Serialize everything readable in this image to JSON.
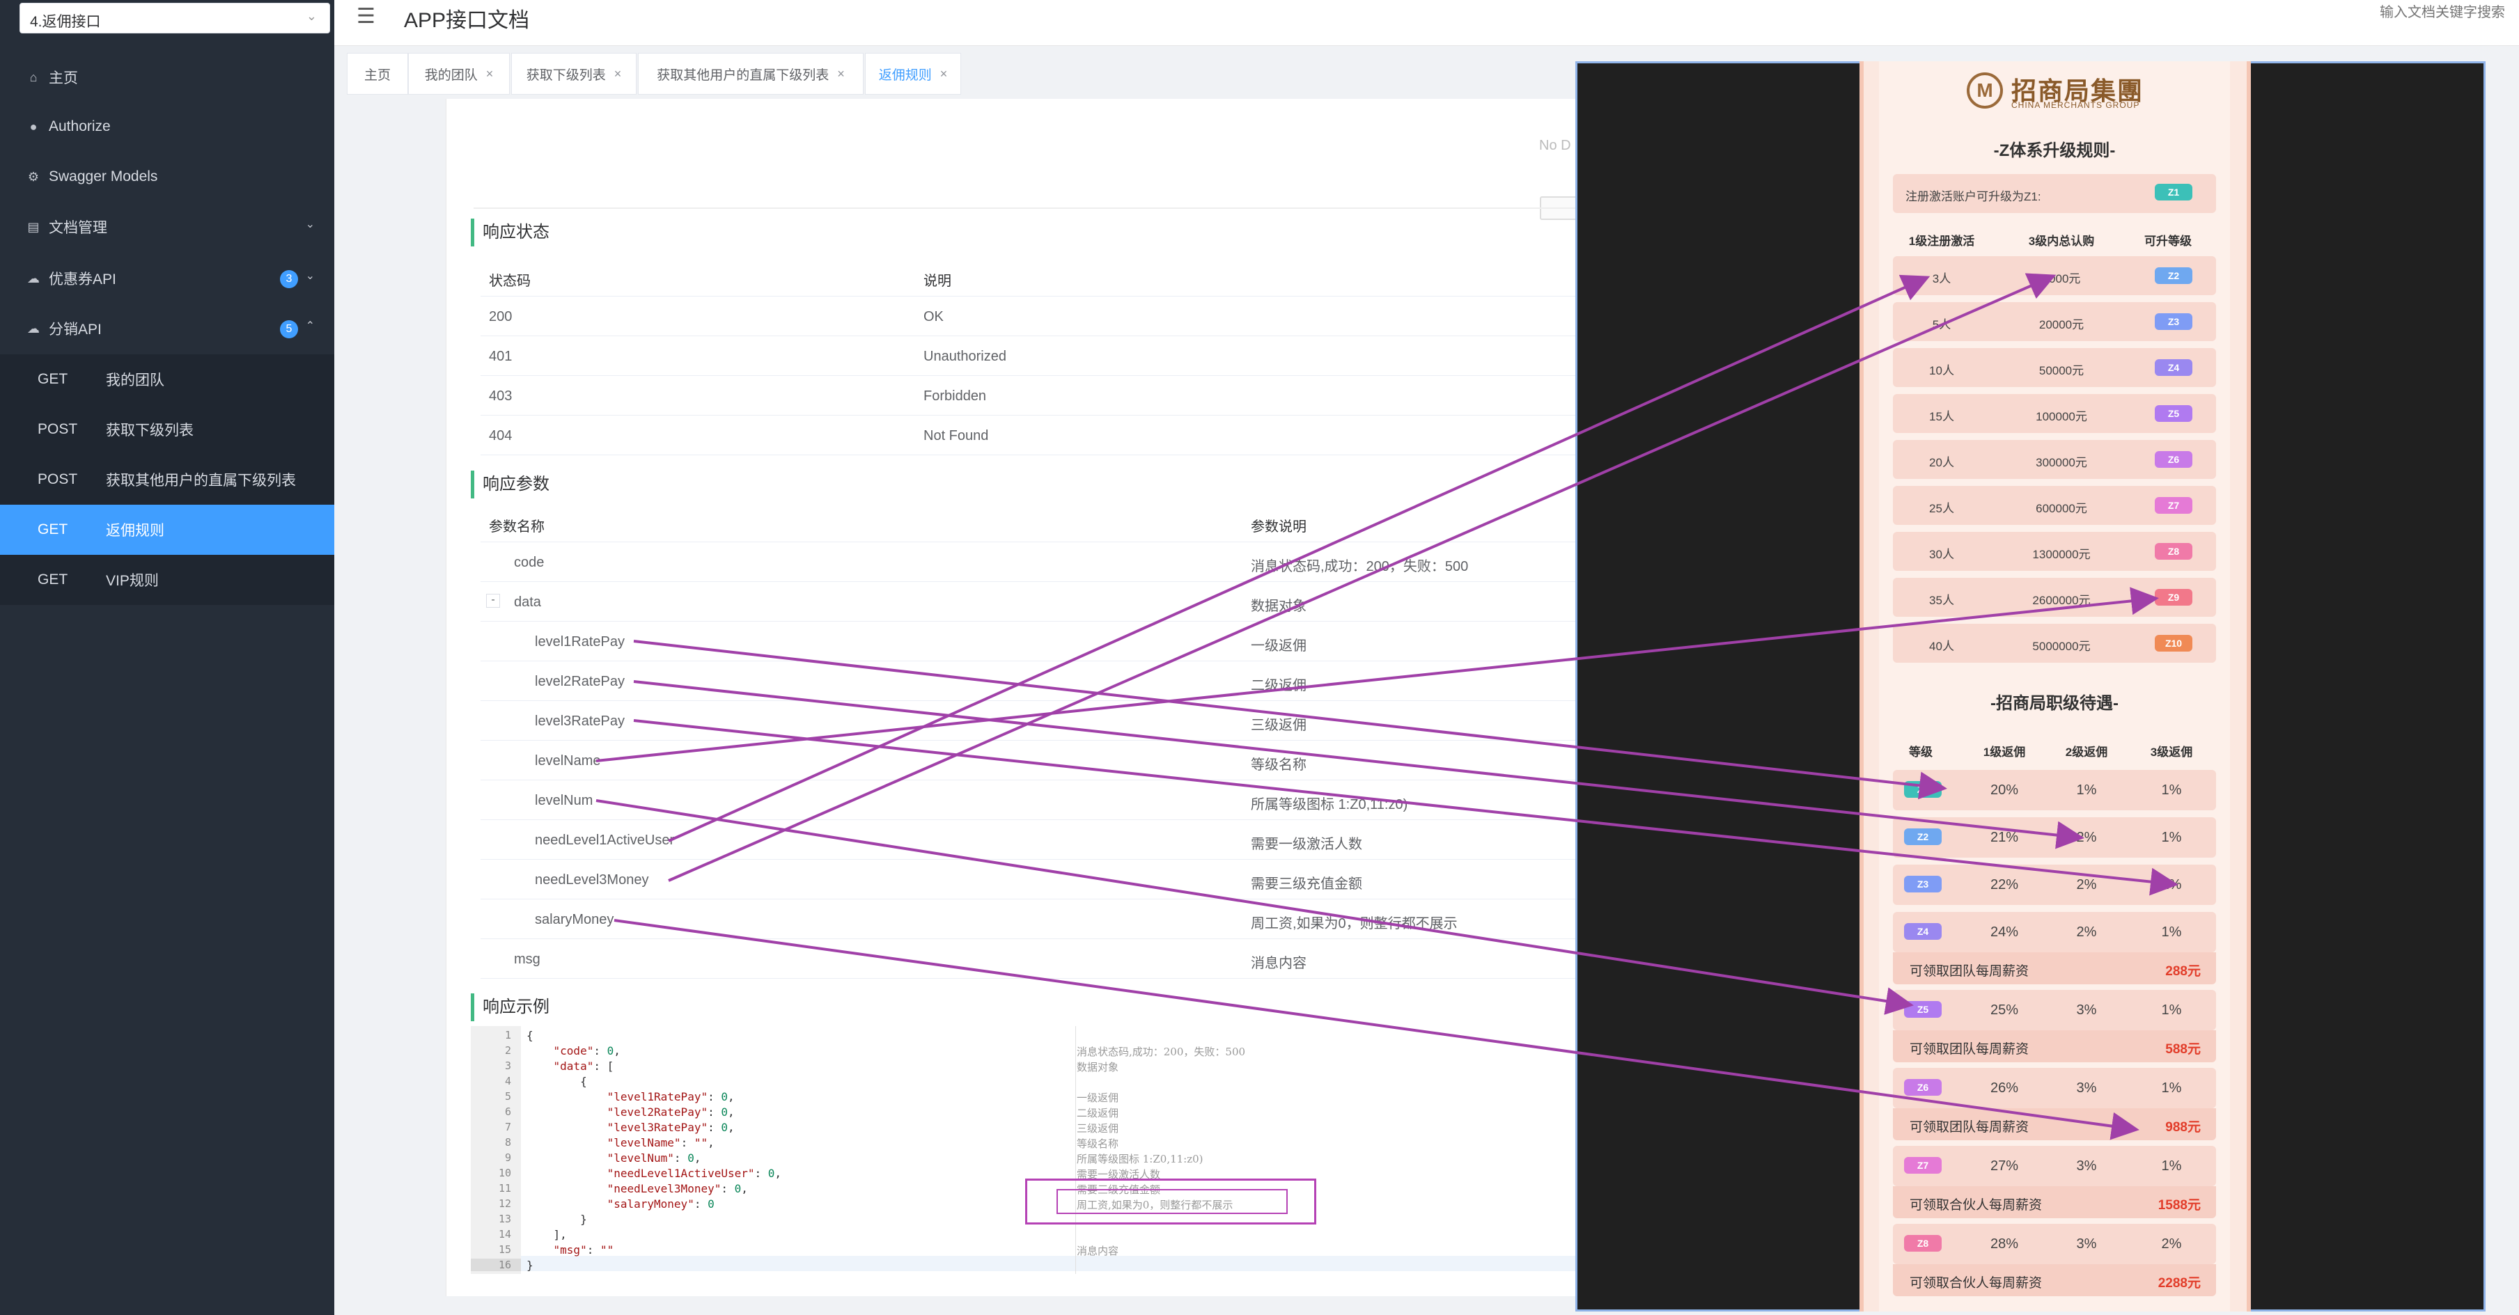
{
  "sidebar": {
    "select_value": "4.返佣接口",
    "menu": [
      {
        "label": "主页",
        "icon": "home-icon",
        "glyph": "⌂"
      },
      {
        "label": "Authorize",
        "icon": "lock-icon",
        "glyph": "●"
      },
      {
        "label": "Swagger Models",
        "icon": "gear-icon",
        "glyph": "⚙"
      },
      {
        "label": "文档管理",
        "icon": "document-icon",
        "glyph": "▤"
      },
      {
        "label": "优惠券API",
        "icon": "cloud-icon",
        "glyph": "☁",
        "badge": "3"
      },
      {
        "label": "分销API",
        "icon": "cloud-icon",
        "glyph": "☁",
        "badge": "5"
      }
    ],
    "sub_items": [
      {
        "method": "GET",
        "label": "我的团队"
      },
      {
        "method": "POST",
        "label": "获取下级列表"
      },
      {
        "method": "POST",
        "label": "获取其他用户的直属下级列表"
      },
      {
        "method": "GET",
        "label": "返佣规则"
      },
      {
        "method": "GET",
        "label": "VIP规则"
      }
    ]
  },
  "header": {
    "title": "APP接口文档",
    "search_placeholder": "输入文档关键字搜索"
  },
  "tabs": [
    {
      "label": "主页"
    },
    {
      "label": "我的团队",
      "close": "×"
    },
    {
      "label": "获取下级列表",
      "close": "×"
    },
    {
      "label": "获取其他用户的直属下级列表",
      "close": "×"
    },
    {
      "label": "返佣规则",
      "close": "×"
    }
  ],
  "empty": {
    "label": "No D"
  },
  "response_status": {
    "title": "响应状态",
    "headers": [
      "状态码",
      "说明"
    ],
    "rows": [
      [
        "200",
        "OK"
      ],
      [
        "401",
        "Unauthorized"
      ],
      [
        "403",
        "Forbidden"
      ],
      [
        "404",
        "Not Found"
      ]
    ]
  },
  "response_params": {
    "title": "响应参数",
    "headers": [
      "参数名称",
      "参数说明"
    ],
    "expand_symbol": "-",
    "rows": [
      [
        "code",
        "消息状态码,成功：200，失败：500"
      ],
      [
        "data",
        "数据对象"
      ],
      [
        "level1RatePay",
        "一级返佣"
      ],
      [
        "level2RatePay",
        "二级返佣"
      ],
      [
        "level3RatePay",
        "三级返佣"
      ],
      [
        "levelName",
        "等级名称"
      ],
      [
        "levelNum",
        "所属等级图标 1:Z0,11:z0)"
      ],
      [
        "needLevel1ActiveUser",
        "需要一级激活人数"
      ],
      [
        "needLevel3Money",
        "需要三级充值金额"
      ],
      [
        "salaryMoney",
        "周工资,如果为0，则整行都不展示"
      ],
      [
        "msg",
        "消息内容"
      ]
    ]
  },
  "response_example": {
    "title": "响应示例",
    "line_numbers": [
      "1",
      "2",
      "3",
      "4",
      "5",
      "6",
      "7",
      "8",
      "9",
      "10",
      "11",
      "12",
      "13",
      "14",
      "15",
      "16"
    ],
    "comments": [
      "消息状态码,成功：200，失败：500",
      "数据对象",
      "一级返佣",
      "二级返佣",
      "三级返佣",
      "等级名称",
      "所属等级图标 1:Z0,11:z0)",
      "需要一级激活人数",
      "需要三级充值金额",
      "周工资,如果为0，则整行都不展示",
      "消息内容"
    ]
  },
  "poster": {
    "logo": "招商局集團",
    "logo_en": "CHINA MERCHANTS GROUP",
    "logo_mark": "M",
    "upgrade_title": "-Z体系升级规则-",
    "register_note": "注册激活账户可升级为Z1:",
    "register_level": "Z1",
    "upgrade_headers": [
      "1级注册激活",
      "3级内总认购",
      "可升等级"
    ],
    "upgrade_rows": [
      {
        "people": "3人",
        "amount": "3000元",
        "level": "Z2",
        "color": "#6fa8f0"
      },
      {
        "people": "5人",
        "amount": "20000元",
        "level": "Z3",
        "color": "#7f9cf5"
      },
      {
        "people": "10人",
        "amount": "50000元",
        "level": "Z4",
        "color": "#9a88f0"
      },
      {
        "people": "15人",
        "amount": "100000元",
        "level": "Z5",
        "color": "#b07af0"
      },
      {
        "people": "20人",
        "amount": "300000元",
        "level": "Z6",
        "color": "#c87ae8"
      },
      {
        "people": "25人",
        "amount": "600000元",
        "level": "Z7",
        "color": "#e57ad6"
      },
      {
        "people": "30人",
        "amount": "1300000元",
        "level": "Z8",
        "color": "#f07aa8"
      },
      {
        "people": "35人",
        "amount": "2600000元",
        "level": "Z9",
        "color": "#f2788a"
      },
      {
        "people": "40人",
        "amount": "5000000元",
        "level": "Z10",
        "color": "#f08a55"
      }
    ],
    "benefit_title": "-招商局职级待遇-",
    "benefit_headers": [
      "等级",
      "1级返佣",
      "2级返佣",
      "3级返佣"
    ],
    "benefit_rows": [
      {
        "level": "Z1",
        "l1": "20%",
        "l2": "1%",
        "l3": "1%",
        "color": "#3cc0b8"
      },
      {
        "level": "Z2",
        "l1": "21%",
        "l2": "2%",
        "l3": "1%",
        "color": "#6fa8f0"
      },
      {
        "level": "Z3",
        "l1": "22%",
        "l2": "2%",
        "l3": "1%",
        "color": "#7f9cf5"
      },
      {
        "level": "Z4",
        "l1": "24%",
        "l2": "2%",
        "l3": "1%",
        "color": "#9a88f0",
        "salary_label": "可领取团队每周薪资",
        "salary": "288元"
      },
      {
        "level": "Z5",
        "l1": "25%",
        "l2": "3%",
        "l3": "1%",
        "color": "#b07af0",
        "salary_label": "可领取团队每周薪资",
        "salary": "588元"
      },
      {
        "level": "Z6",
        "l1": "26%",
        "l2": "3%",
        "l3": "1%",
        "color": "#c87ae8",
        "salary_label": "可领取团队每周薪资",
        "salary": "988元"
      },
      {
        "level": "Z7",
        "l1": "27%",
        "l2": "3%",
        "l3": "1%",
        "color": "#e57ad6",
        "salary_label": "可领取合伙人每周薪资",
        "salary": "1588元"
      },
      {
        "level": "Z8",
        "l1": "28%",
        "l2": "3%",
        "l3": "2%",
        "color": "#f07aa8",
        "salary_label": "可领取合伙人每周薪资",
        "salary": "2288元"
      }
    ]
  },
  "colors": {
    "accent": "#409eff",
    "sidebar": "#262e39",
    "arrow": "#a040a8",
    "section_bar": "#42b983",
    "salary_red": "#e23d2a"
  }
}
